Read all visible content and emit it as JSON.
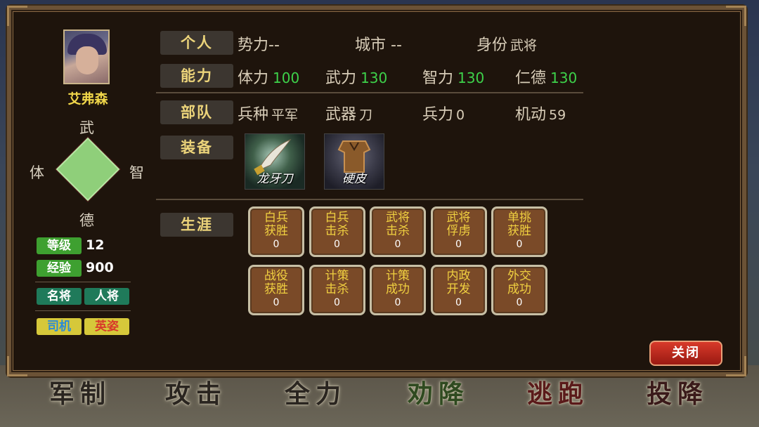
{
  "background_commands": [
    {
      "label": "军制",
      "color": "#2a2520"
    },
    {
      "label": "攻击",
      "color": "#2a2520"
    },
    {
      "label": "全力",
      "color": "#2a2520"
    },
    {
      "label": "劝降",
      "color": "#2f4a20"
    },
    {
      "label": "逃跑",
      "color": "#5a1a1a"
    },
    {
      "label": "投降",
      "color": "#3a1a1a"
    }
  ],
  "general": {
    "name": "艾弗森",
    "radar": {
      "top": "武",
      "left": "体",
      "right": "智",
      "bottom": "德"
    },
    "level_label": "等级",
    "level": "12",
    "exp_label": "经验",
    "exp": "900",
    "tags1": [
      "名将",
      "人将"
    ],
    "tags2": [
      "司机",
      "英姿"
    ]
  },
  "personal": {
    "label": "个人",
    "faction_label": "势力",
    "faction": "--",
    "city_label": "城市",
    "city": "--",
    "identity_label": "身份",
    "identity": "武将"
  },
  "ability": {
    "label": "能力",
    "stats": [
      {
        "name": "体力",
        "value": "100"
      },
      {
        "name": "武力",
        "value": "130"
      },
      {
        "name": "智力",
        "value": "130"
      },
      {
        "name": "仁德",
        "value": "130"
      }
    ]
  },
  "troop": {
    "label": "部队",
    "type_label": "兵种",
    "type": "平军",
    "weapon_label": "武器",
    "weapon": "刀",
    "soldiers_label": "兵力",
    "soldiers": "0",
    "mobility_label": "机动",
    "mobility": "59"
  },
  "equipment": {
    "label": "装备",
    "items": [
      {
        "name": "龙牙刀",
        "icon": "dragon-fang-blade-icon"
      },
      {
        "name": "硬皮",
        "icon": "hard-leather-armor-icon"
      }
    ]
  },
  "career": {
    "label": "生涯",
    "items": [
      {
        "l1": "白兵",
        "l2": "获胜",
        "count": "0"
      },
      {
        "l1": "白兵",
        "l2": "击杀",
        "count": "0"
      },
      {
        "l1": "武将",
        "l2": "击杀",
        "count": "0"
      },
      {
        "l1": "武将",
        "l2": "俘虏",
        "count": "0"
      },
      {
        "l1": "单挑",
        "l2": "获胜",
        "count": "0"
      },
      {
        "l1": "战役",
        "l2": "获胜",
        "count": "0"
      },
      {
        "l1": "计策",
        "l2": "击杀",
        "count": "0"
      },
      {
        "l1": "计策",
        "l2": "成功",
        "count": "0"
      },
      {
        "l1": "内政",
        "l2": "开发",
        "count": "0"
      },
      {
        "l1": "外交",
        "l2": "成功",
        "count": "0"
      }
    ]
  },
  "close_label": "关闭"
}
